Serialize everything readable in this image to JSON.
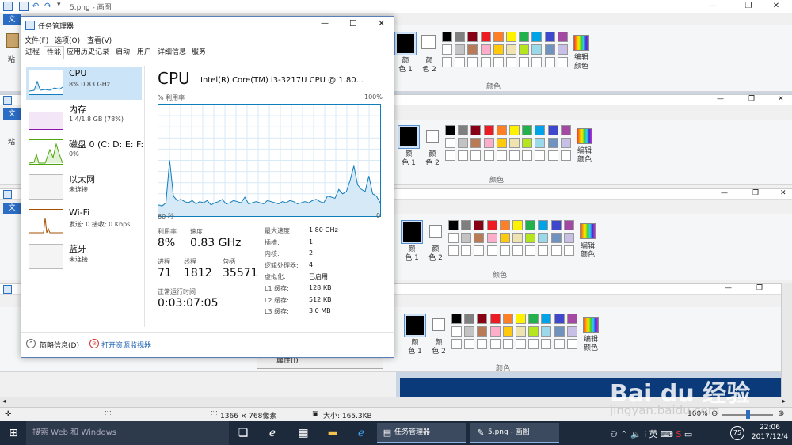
{
  "paint": {
    "title": "5.png - 画图",
    "file_tab": "文",
    "paste_label": "粘",
    "color1_label": "颜",
    "color1_sub": "色 1",
    "color2_label": "颜",
    "color2_sub": "色 2",
    "edit_colors_label": "编辑",
    "edit_colors_sub": "颜色",
    "colors_group": "颜色",
    "minimize": "—",
    "restore": "❐",
    "close": "✕",
    "palette_row1": [
      "#000000",
      "#7f7f7f",
      "#880015",
      "#ed1c24",
      "#ff7f27",
      "#fff200",
      "#22b14c",
      "#00a2e8",
      "#3f48cc",
      "#a349a4"
    ],
    "palette_row2": [
      "#ffffff",
      "#c3c3c3",
      "#b97a57",
      "#ffaec9",
      "#ffc90e",
      "#efe4b0",
      "#b5e61d",
      "#99d9ea",
      "#7092be",
      "#c8bfe7"
    ],
    "properties_label": "属性(I)",
    "status": {
      "dimensions": "1366 × 768像素",
      "size": "大小: 165.3KB",
      "zoom": "100%"
    }
  },
  "task_manager": {
    "title": "任务管理器",
    "controls": {
      "minimize": "—",
      "maximize": "☐",
      "close": "✕"
    },
    "menu": [
      "文件(F)",
      "选项(O)",
      "查看(V)"
    ],
    "tabs": [
      "进程",
      "性能",
      "应用历史记录",
      "启动",
      "用户",
      "详细信息",
      "服务"
    ],
    "sidebar": [
      {
        "name": "CPU",
        "sub": "8% 0.83 GHz",
        "color": "#117dbb"
      },
      {
        "name": "内存",
        "sub": "1.4/1.8 GB (78%)",
        "color": "#8b12ae"
      },
      {
        "name": "磁盘 0 (C: D: E: F:",
        "sub": "0%",
        "color": "#4da60c"
      },
      {
        "name": "以太网",
        "sub": "未连接",
        "color": "#a74f01"
      },
      {
        "name": "Wi-Fi",
        "sub": "发送: 0 接收: 0 Kbps",
        "color": "#a74f01"
      },
      {
        "name": "蓝牙",
        "sub": "未连接",
        "color": "#a74f01"
      }
    ],
    "cpu": {
      "heading": "CPU",
      "model": "Intel(R) Core(TM) i3-3217U CPU @ 1.80...",
      "graph_label": "% 利用率",
      "graph_max": "100%",
      "time_left": "60 秒",
      "time_right": "0",
      "utilization_label": "利用率",
      "utilization": "8%",
      "speed_label": "速度",
      "speed": "0.83 GHz",
      "processes_label": "进程",
      "processes": "71",
      "threads_label": "线程",
      "threads": "1812",
      "handles_label": "句柄",
      "handles": "35571",
      "uptime_label": "正常运行时间",
      "uptime": "0:03:07:05",
      "details": [
        {
          "label": "最大速度:",
          "value": "1.80 GHz"
        },
        {
          "label": "插槽:",
          "value": "1"
        },
        {
          "label": "内核:",
          "value": "2"
        },
        {
          "label": "逻辑处理器:",
          "value": "4"
        },
        {
          "label": "虚拟化:",
          "value": "已启用"
        },
        {
          "label": "L1 缓存:",
          "value": "128 KB"
        },
        {
          "label": "L2 缓存:",
          "value": "512 KB"
        },
        {
          "label": "L3 缓存:",
          "value": "3.0 MB"
        }
      ],
      "usage_history": [
        10,
        9,
        12,
        50,
        18,
        14,
        15,
        13,
        12,
        14,
        11,
        13,
        12,
        14,
        10,
        12,
        13,
        15,
        11,
        12,
        14,
        13,
        12,
        17,
        11,
        12,
        13,
        12,
        11,
        14,
        13,
        12,
        11,
        13,
        12,
        14,
        13,
        11,
        12,
        13,
        12,
        14,
        15,
        13,
        12,
        18,
        17,
        16,
        24,
        20,
        22,
        32,
        45,
        28,
        24,
        22,
        36,
        20,
        18,
        12
      ]
    },
    "footer": {
      "summary": "简略信息(D)",
      "resource_monitor": "打开资源监视器"
    }
  },
  "taskbar": {
    "search_placeholder": "搜索 Web 和 Windows",
    "app1": "任务管理器",
    "app2": "5.png - 画图",
    "battery": "75",
    "time": "22:06",
    "date": "2017/12/4"
  },
  "watermark": {
    "brand": "Bai du 经验",
    "url": "jingyan.baidu.com"
  }
}
